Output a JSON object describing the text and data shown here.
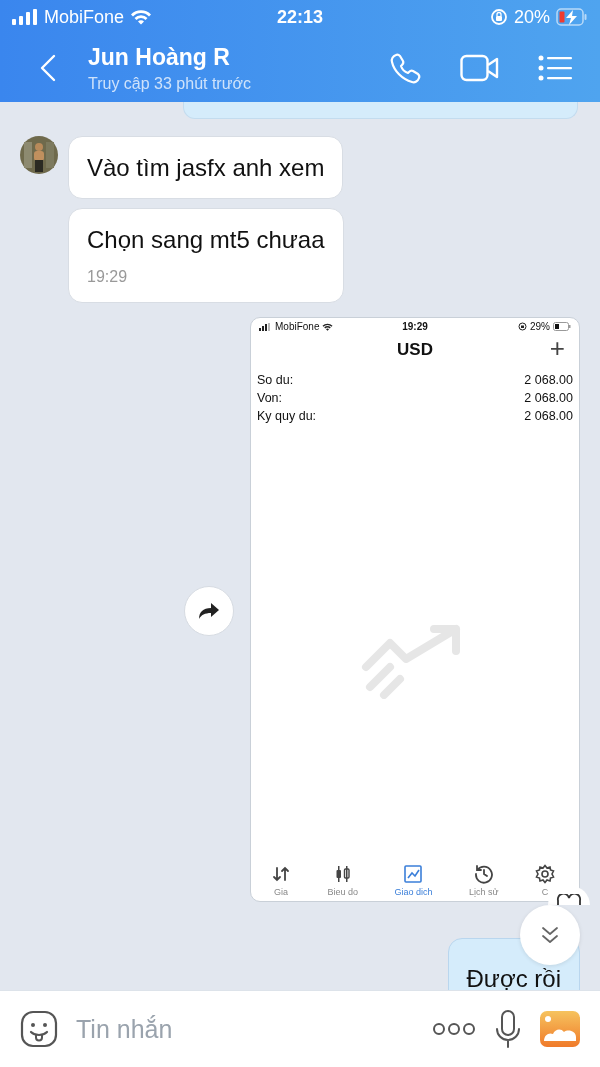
{
  "status_bar": {
    "carrier": "MobiFone",
    "time": "22:13",
    "battery": "20%",
    "charging": true
  },
  "header": {
    "title": "Jun Hoàng R",
    "subtitle": "Truy cập 33 phút trước"
  },
  "messages": [
    {
      "kind": "sent_partial"
    },
    {
      "kind": "received",
      "text": "Vào tìm jasfx anh xem",
      "avatar": true
    },
    {
      "kind": "received",
      "text": "Chọn sang mt5 chưaa",
      "time": "19:29",
      "avatar": false
    },
    {
      "kind": "image",
      "screen": {
        "carrier": "MobiFone",
        "time": "19:29",
        "battery": "29%",
        "title": "USD",
        "plus": "+",
        "rows": [
          {
            "label": "So du:",
            "value": "2 068.00"
          },
          {
            "label": "Von:",
            "value": "2 068.00"
          },
          {
            "label": "Ky quy du:",
            "value": "2 068.00"
          }
        ],
        "tabs": [
          {
            "label": "Gia",
            "kind": "arrows",
            "selected": false
          },
          {
            "label": "Bieu do",
            "kind": "candles",
            "selected": false
          },
          {
            "label": "Giao dich",
            "kind": "trade",
            "selected": true
          },
          {
            "label": "Lịch sử",
            "kind": "history",
            "selected": false
          },
          {
            "label": "C",
            "kind": "gear",
            "selected": false
          }
        ]
      }
    },
    {
      "kind": "sent",
      "text": "Được rồi"
    }
  ],
  "composer": {
    "placeholder": "Tin nhắn"
  }
}
